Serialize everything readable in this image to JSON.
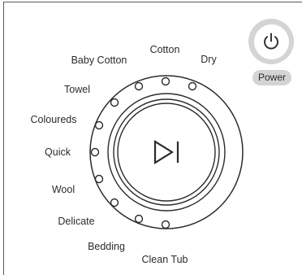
{
  "power": {
    "label": "Power",
    "icon": "power-icon"
  },
  "start_pause": {
    "icon": "play-pause-icon"
  },
  "programs": [
    {
      "label": "Cotton"
    },
    {
      "label": "Dry"
    },
    {
      "label": "Baby Cotton"
    },
    {
      "label": "Towel"
    },
    {
      "label": "Coloureds"
    },
    {
      "label": "Quick"
    },
    {
      "label": "Wool"
    },
    {
      "label": "Delicate"
    },
    {
      "label": "Bedding"
    },
    {
      "label": "Clean Tub"
    }
  ],
  "colors": {
    "ink": "#2b2b2b",
    "power_ring": "#d4d4d4"
  }
}
